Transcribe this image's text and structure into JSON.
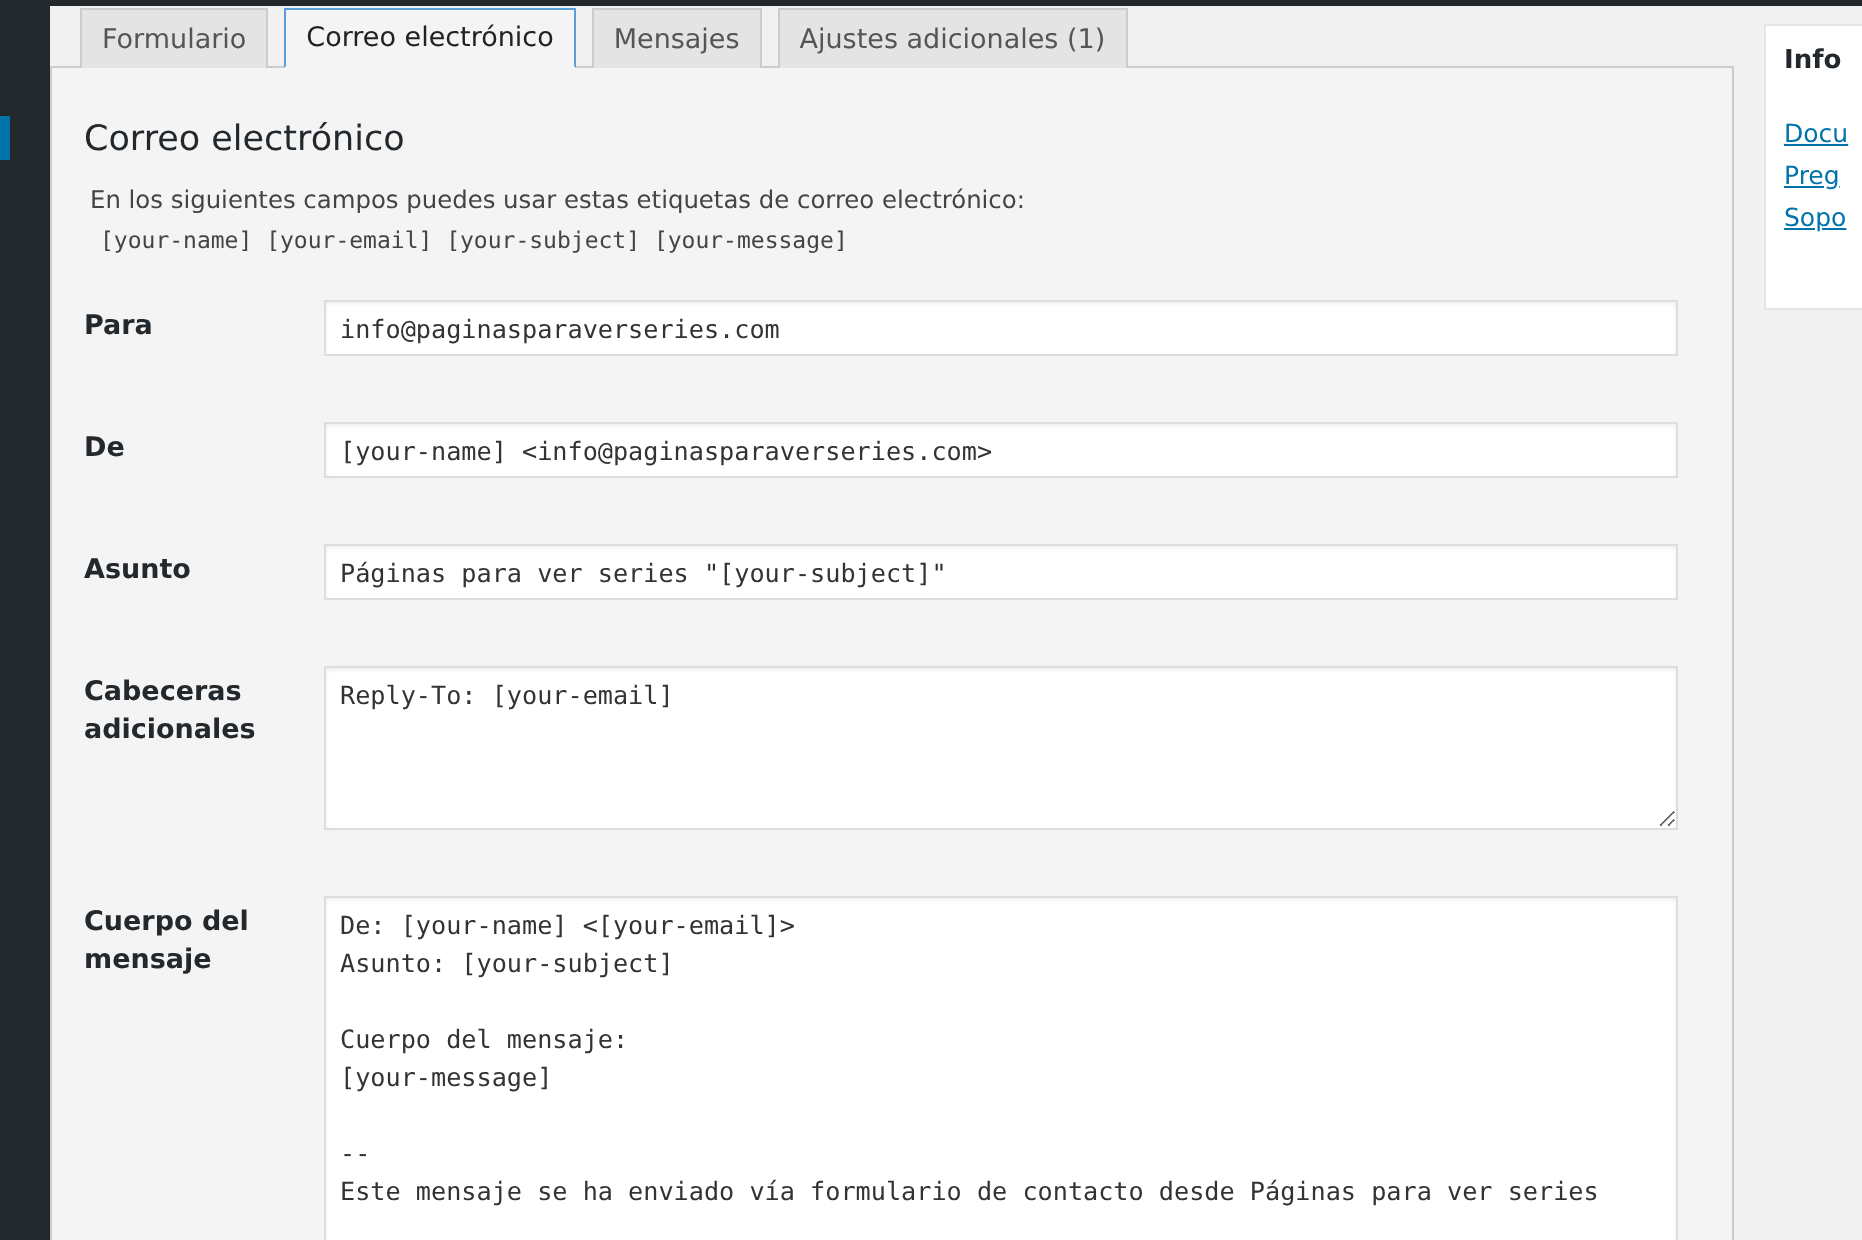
{
  "tabs": [
    {
      "label": "Formulario",
      "selected": false
    },
    {
      "label": "Correo electrónico",
      "selected": true
    },
    {
      "label": "Mensajes",
      "selected": false
    },
    {
      "label": "Ajustes adicionales (1)",
      "selected": false
    }
  ],
  "panel": {
    "title": "Correo electrónico",
    "description": "En los siguientes campos puedes usar estas etiquetas de correo electrónico:",
    "tags": "[your-name] [your-email] [your-subject] [your-message]"
  },
  "fields": [
    {
      "kind": "input",
      "label": "Para",
      "value": "info@paginasparaverseries.com"
    },
    {
      "kind": "input",
      "label": "De",
      "value": "[your-name] <info@paginasparaverseries.com>"
    },
    {
      "kind": "input",
      "label": "Asunto",
      "value": "Páginas para ver series \"[your-subject]\""
    },
    {
      "kind": "textarea",
      "label": "Cabeceras adicionales",
      "value": "Reply-To: [your-email]"
    },
    {
      "kind": "textarea_tall",
      "label": "Cuerpo del mensaje",
      "value": "De: [your-name] <[your-email]>\nAsunto: [your-subject]\n\nCuerpo del mensaje:\n[your-message]\n\n--\nEste mensaje se ha enviado vía formulario de contacto desde Páginas para ver series"
    }
  ],
  "info_box": {
    "title": "Info",
    "links": [
      "Docu",
      "Preg",
      "Sopo"
    ]
  }
}
